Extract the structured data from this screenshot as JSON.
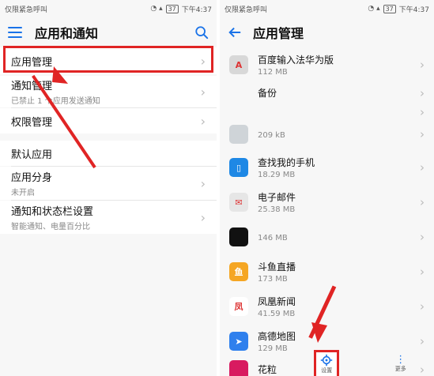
{
  "left": {
    "status": {
      "carrier": "仅限紧急呼叫",
      "battery": "37",
      "time": "下午4:37"
    },
    "title": "应用和通知",
    "items": [
      {
        "label": "应用管理",
        "sub": ""
      },
      {
        "label": "通知管理",
        "sub": "已禁止 1 个应用发送通知"
      },
      {
        "label": "权限管理",
        "sub": ""
      },
      {
        "label": "默认应用",
        "sub": ""
      },
      {
        "label": "应用分身",
        "sub": "未开启"
      },
      {
        "label": "通知和状态栏设置",
        "sub": "智能通知、电量百分比"
      }
    ]
  },
  "right": {
    "status": {
      "carrier": "仅限紧急呼叫",
      "battery": "37",
      "time": "下午4:37"
    },
    "title": "应用管理",
    "apps": [
      {
        "name": "百度输入法华为版",
        "size": "112 MB",
        "icon": "A",
        "color": "#d8d8d8"
      },
      {
        "name": "备份",
        "size": "",
        "icon": "",
        "color": "#f7f7f7"
      },
      {
        "name": "",
        "size": "",
        "icon": "",
        "color": "#f7f7f7"
      },
      {
        "name": "",
        "size": "209 kB",
        "icon": "",
        "color": "#cfd4d8"
      },
      {
        "name": "查找我的手机",
        "size": "18.29 MB",
        "icon": "▯",
        "color": "#1e88e5"
      },
      {
        "name": "电子邮件",
        "size": "25.38 MB",
        "icon": "✉",
        "color": "#e6e6e6"
      },
      {
        "name": "",
        "size": "146 MB",
        "icon": "",
        "color": "#111111"
      },
      {
        "name": "斗鱼直播",
        "size": "173 MB",
        "icon": "鱼",
        "color": "#f5a623"
      },
      {
        "name": "凤凰新闻",
        "size": "41.59 MB",
        "icon": "凤",
        "color": "#ffffff"
      },
      {
        "name": "高德地图",
        "size": "129 MB",
        "icon": "➤",
        "color": "#2f80ed"
      },
      {
        "name": "花粒",
        "size": "",
        "icon": "",
        "color": "#d81b60"
      }
    ],
    "toolbar": {
      "settings": "设置",
      "more": "更多"
    }
  },
  "colors": {
    "accent": "#1a73e8",
    "highlight": "#e02424"
  }
}
